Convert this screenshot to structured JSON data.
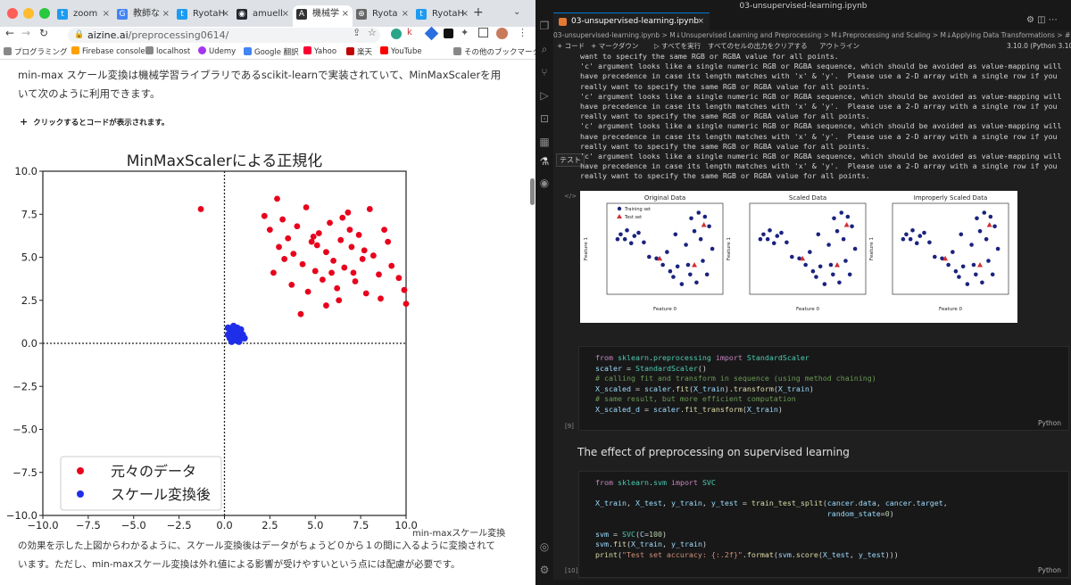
{
  "browser": {
    "tabs": [
      {
        "label": "zoom",
        "icon": "twitter-icon",
        "color": "#1d9bf0"
      },
      {
        "label": "教師な",
        "icon": "google-icon",
        "color": "#4285f4"
      },
      {
        "label": "RyotaH",
        "icon": "twitter-icon",
        "color": "#1d9bf0"
      },
      {
        "label": "amuell",
        "icon": "github-icon",
        "color": "#24292f"
      },
      {
        "label": "機械学",
        "icon": "site-icon",
        "color": "#333333",
        "active": true
      },
      {
        "label": "Ryota",
        "icon": "globe-icon",
        "color": "#666666"
      },
      {
        "label": "RyotaH",
        "icon": "twitter-icon",
        "color": "#1d9bf0"
      }
    ],
    "url_host": "aizine.ai",
    "url_path": "/preprocessing0614/",
    "bookmarks": [
      "プログラミング",
      "Firebase console",
      "localhost",
      "Udemy",
      "Google 翻訳",
      "Yahoo",
      "楽天",
      "YouTube"
    ],
    "other_bookmarks": "その他のブックマーク"
  },
  "article": {
    "para1": "min-max スケール変換は機械学習ライブラリであるscikit-learnで実装されていて、MinMaxScalerを用いて次のように利用できます。",
    "expander": "クリックするとコードが表示されます。",
    "para2_head": "min-maxスケール変換",
    "para2": "の効果を示した上図からわかるように、スケール変換後はデータがちょうど０から１の間に入るように変換されています。ただし、min-maxスケール変換は外れ値による影響が受けやすいという点には配慮が必要です。"
  },
  "chart_data": {
    "type": "scatter",
    "title": "MinMaxScalerによる正規化",
    "xlim": [
      -10,
      10
    ],
    "ylim": [
      -10,
      10
    ],
    "xticks": [
      "−10.0",
      "−7.5",
      "−5.0",
      "−2.5",
      "0.0",
      "2.5",
      "5.0",
      "7.5",
      "10.0"
    ],
    "yticks": [
      "10.0",
      "7.5",
      "5.0",
      "2.5",
      "0.0",
      "−2.5",
      "−5.0",
      "−7.5",
      "−10.0"
    ],
    "series": [
      {
        "name": "元々のデータ",
        "color": "#e8001c",
        "points": [
          [
            -1.3,
            7.8
          ],
          [
            2.2,
            7.4
          ],
          [
            2.5,
            6.6
          ],
          [
            2.9,
            8.4
          ],
          [
            3.2,
            7.2
          ],
          [
            3.5,
            6.1
          ],
          [
            3.8,
            5.2
          ],
          [
            4.0,
            6.8
          ],
          [
            4.3,
            4.6
          ],
          [
            4.5,
            7.9
          ],
          [
            4.8,
            5.9
          ],
          [
            5.0,
            4.2
          ],
          [
            5.2,
            6.4
          ],
          [
            5.4,
            3.7
          ],
          [
            5.6,
            5.3
          ],
          [
            5.8,
            7.0
          ],
          [
            6.0,
            4.8
          ],
          [
            6.2,
            3.2
          ],
          [
            6.4,
            6.0
          ],
          [
            6.6,
            4.4
          ],
          [
            6.8,
            7.6
          ],
          [
            7.0,
            5.6
          ],
          [
            7.2,
            3.6
          ],
          [
            7.4,
            6.3
          ],
          [
            7.6,
            4.9
          ],
          [
            7.8,
            2.9
          ],
          [
            8.0,
            7.8
          ],
          [
            8.2,
            5.1
          ],
          [
            8.5,
            4.0
          ],
          [
            8.8,
            6.6
          ],
          [
            9.2,
            4.5
          ],
          [
            9.6,
            3.8
          ],
          [
            9.9,
            3.1
          ],
          [
            4.2,
            1.7
          ],
          [
            5.6,
            2.2
          ],
          [
            3.7,
            3.4
          ],
          [
            6.3,
            2.5
          ],
          [
            3.0,
            5.6
          ],
          [
            2.7,
            4.1
          ],
          [
            4.6,
            3.0
          ],
          [
            5.1,
            5.7
          ],
          [
            6.9,
            6.6
          ],
          [
            8.6,
            2.6
          ],
          [
            7.1,
            4.1
          ],
          [
            5.9,
            4.1
          ],
          [
            4.9,
            6.2
          ],
          [
            3.3,
            4.9
          ],
          [
            6.5,
            7.3
          ],
          [
            7.7,
            5.4
          ],
          [
            9.0,
            5.9
          ],
          [
            10.0,
            2.3
          ]
        ]
      },
      {
        "name": "スケール変換後",
        "color": "#1f2ee8",
        "points": [
          [
            0.3,
            0.8
          ],
          [
            0.5,
            0.4
          ],
          [
            0.7,
            0.9
          ],
          [
            0.9,
            0.3
          ],
          [
            0.4,
            0.6
          ],
          [
            0.6,
            0.2
          ],
          [
            0.8,
            0.7
          ],
          [
            0.2,
            0.9
          ],
          [
            1.0,
            0.5
          ],
          [
            0.5,
            1.0
          ],
          [
            0.3,
            0.3
          ],
          [
            0.7,
            0.5
          ],
          [
            0.9,
            0.8
          ],
          [
            0.4,
            0.1
          ],
          [
            0.6,
            0.7
          ],
          [
            1.1,
            0.3
          ],
          [
            0.8,
            0.1
          ],
          [
            0.2,
            0.5
          ]
        ]
      }
    ]
  },
  "vscode": {
    "window_title": "03-unsupervised-learning.ipynb",
    "tab_label": "03-unsupervised-learning.ipynb",
    "breadcrumb": "03-unsupervised-learning.ipynb > M↓Unsupervised Learning and Preprocessing > M↓Preprocessing and Scaling > M↓Applying Data Transformations > # transform data",
    "toolbar": [
      "+ コード",
      "+ マークダウン",
      "▷ すべてを実行",
      "すべてのセルの出力をクリアする",
      "アウトライン",
      "3.10.0 (Python 3.10.0)"
    ],
    "warning_line": "'c' argument looks like a single numeric RGB or RGBA sequence, which should be avoided as value-mapping will have precedence in case its length matches with 'x' & 'y'.  Please use a 2-D array with a single row if you really want to specify the same RGB or RGBA value for all points.",
    "first_line": "want to specify the same RGB or RGBA value for all points.",
    "plot_titles": [
      "Original Data",
      "Scaled Data",
      "Improperly Scaled Data"
    ],
    "legend": [
      "Training set",
      "Test set"
    ],
    "axis_x": "Feature 0",
    "axis_y": "Feature 1",
    "cell9_number": "[9]",
    "cell10_number": "[10]",
    "lang": "Python",
    "heading": "The effect of preprocessing on supervised learning",
    "tooltip": "テスト"
  }
}
